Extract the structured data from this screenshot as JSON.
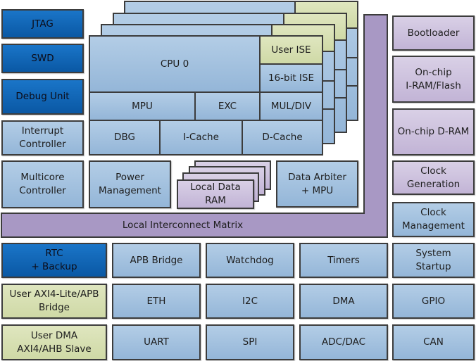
{
  "colors": {
    "dark_blue": "#0a64b4",
    "light_blue": "#a7c4e0",
    "green": "#d4dcaa",
    "purple_light": "#cdc2de",
    "purple_bar": "#a898c4",
    "border": "#3c3c3c"
  },
  "left": {
    "jtag": "JTAG",
    "swd": "SWD",
    "debug": "Debug Unit",
    "interrupt": "Interrupt\nController",
    "multicore": "Multicore\nController"
  },
  "cpu": {
    "name": "CPU 0",
    "user_ise": "User ISE",
    "ise16": "16-bit ISE",
    "mpu": "MPU",
    "exc": "EXC",
    "muldiv": "MUL/DIV",
    "dbg": "DBG",
    "icache": "I-Cache",
    "dcache": "D-Cache"
  },
  "mid": {
    "power": "Power\nManagement",
    "ldram": "Local Data\nRAM",
    "arbiter": "Data Arbiter\n+ MPU",
    "interconnect": "Local Interconnect Matrix"
  },
  "right": {
    "bootloader": "Bootloader",
    "iram": "On-chip\nI-RAM/Flash",
    "dram": "On-chip D-RAM",
    "clockgen": "Clock\nGeneration",
    "clockmgmt": "Clock\nManagement"
  },
  "bottom": {
    "rtc": "RTC\n+ Backup",
    "axilite": "User AXI4-Lite/APB\nBridge",
    "userdma": "User DMA\nAXI4/AHB Slave",
    "apb": "APB Bridge",
    "watchdog": "Watchdog",
    "timers": "Timers",
    "startup": "System\nStartup",
    "eth": "ETH",
    "i2c": "I2C",
    "dma": "DMA",
    "gpio": "GPIO",
    "uart": "UART",
    "spi": "SPI",
    "adc": "ADC/DAC",
    "can": "CAN"
  }
}
